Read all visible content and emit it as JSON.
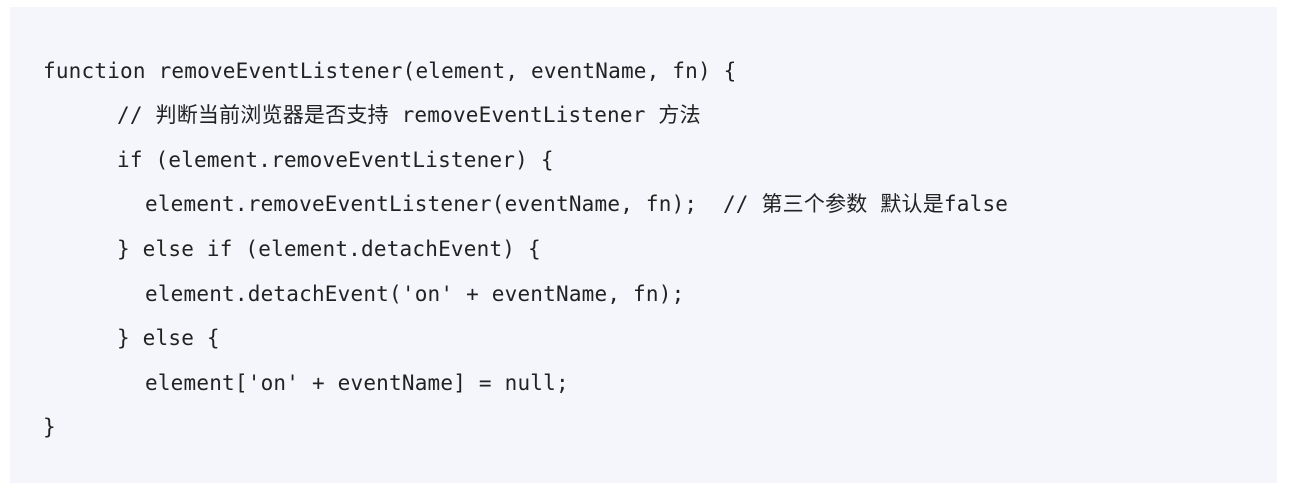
{
  "code": {
    "lines": [
      "function removeEventListener(element, eventName, fn) {",
      "// 判断当前浏览器是否支持 removeEventListener 方法",
      "if (element.removeEventListener) {",
      "element.removeEventListener(eventName, fn);  // 第三个参数 默认是false",
      "} else if (element.detachEvent) {",
      "element.detachEvent('on' + eventName, fn);",
      "} else {",
      "element['on' + eventName] = null;",
      "}"
    ]
  },
  "colors": {
    "panel_background": "#f4f6fb",
    "text": "#222222"
  }
}
